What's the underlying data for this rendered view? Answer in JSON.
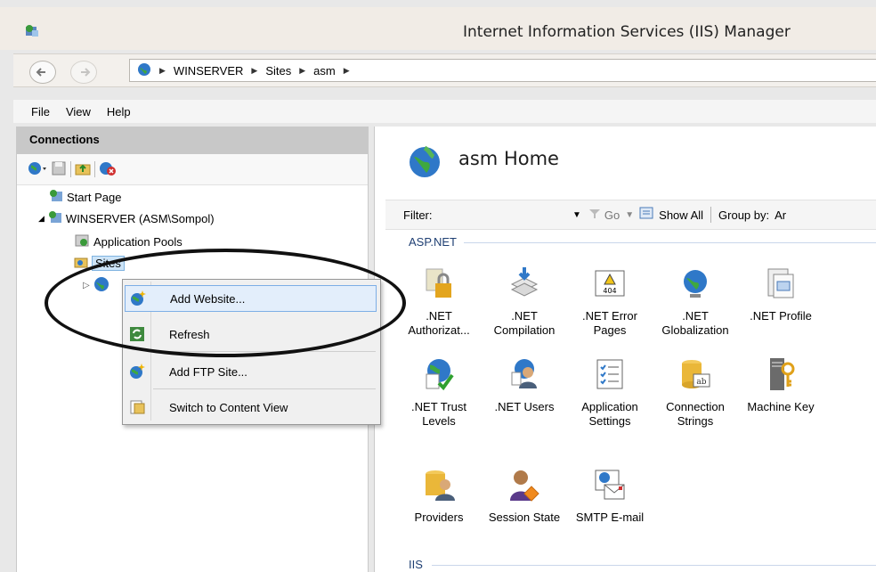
{
  "window": {
    "title": "Internet Information Services (IIS) Manager"
  },
  "address": {
    "segments": [
      "WINSERVER",
      "Sites",
      "asm"
    ]
  },
  "menu": [
    "File",
    "View",
    "Help"
  ],
  "connections": {
    "header": "Connections",
    "tree": {
      "start_page": "Start Page",
      "server": "WINSERVER (ASM\\Sompol)",
      "app_pools": "Application Pools",
      "sites": "Sites"
    }
  },
  "context_menu": {
    "items": [
      "Add Website...",
      "Refresh",
      "Add FTP Site...",
      "Switch to Content View"
    ]
  },
  "main": {
    "title": "asm Home",
    "filter": {
      "label": "Filter:",
      "go": "Go",
      "show_all": "Show All",
      "group_by": "Group by:",
      "group_value": "Ar"
    },
    "sections": [
      "ASP.NET",
      "IIS"
    ],
    "features_row1": [
      ".NET Authorizat...",
      ".NET Compilation",
      ".NET Error Pages",
      ".NET Globalization",
      ".NET Profile"
    ],
    "features_row2": [
      ".NET Trust Levels",
      ".NET Users",
      "Application Settings",
      "Connection Strings",
      "Machine Key"
    ],
    "features_row3": [
      "Providers",
      "Session State",
      "SMTP E-mail"
    ]
  }
}
